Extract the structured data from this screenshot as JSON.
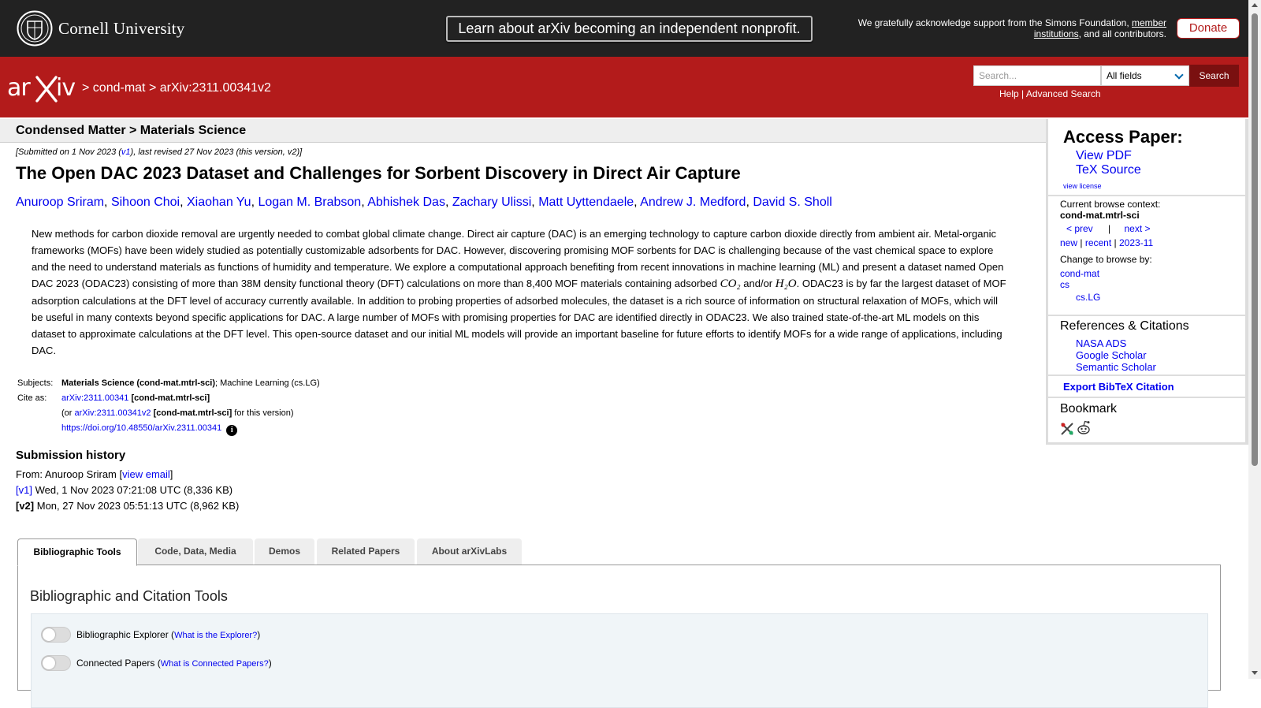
{
  "topbar": {
    "cornell_text": "Cornell University",
    "nonprofit_label": "Learn about arXiv becoming an independent nonprofit.",
    "ack_prefix": "We gratefully acknowledge support from the Simons Foundation, ",
    "ack_link": "member institutions",
    "ack_suffix": ", and all contributors.",
    "donate_label": "Donate"
  },
  "header": {
    "crumb_sep": ">",
    "crumb_1": "cond-mat",
    "crumb_2": "arXiv:2311.00341v2",
    "search_placeholder": "Search...",
    "field_selected": "All fields",
    "search_button": "Search",
    "help": "Help",
    "pipe": "|",
    "advanced": "Advanced Search"
  },
  "subheader": {
    "category": "Condensed Matter > Materials Science"
  },
  "paper": {
    "date_prefix": "[Submitted on 1 Nov 2023 (",
    "date_v1": "v1",
    "date_suffix": "), last revised 27 Nov 2023 (this version, v2)]",
    "title": "The Open DAC 2023 Dataset and Challenges for Sorbent Discovery in Direct Air Capture",
    "authors": [
      "Anuroop Sriram",
      "Sihoon Choi",
      "Xiaohan Yu",
      "Logan M. Brabson",
      "Abhishek Das",
      "Zachary Ulissi",
      "Matt Uyttendaele",
      "Andrew J. Medford",
      "David S. Sholl"
    ],
    "abstract_part1": "New methods for carbon dioxide removal are urgently needed to combat global climate change. Direct air capture (DAC) is an emerging technology to capture carbon dioxide directly from ambient air. Metal-organic frameworks (MOFs) have been widely studied as potentially customizable adsorbents for DAC. However, discovering promising MOF sorbents for DAC is challenging because of the vast chemical space to explore and the need to understand materials as functions of humidity and temperature. We explore a computational approach benefiting from recent innovations in machine learning (ML) and present a dataset named Open DAC 2023 (ODAC23) consisting of more than 38M density functional theory (DFT) calculations on more than 8,400 MOF materials containing adsorbed ",
    "abstract_co2": "CO₂",
    "abstract_and": " and/or ",
    "abstract_h2o": "H₂O",
    "abstract_part2": ". ODAC23 is by far the largest dataset of MOF adsorption calculations at the DFT level of accuracy currently available. In addition to probing properties of adsorbed molecules, the dataset is a rich source of information on structural relaxation of MOFs, which will be useful in many contexts beyond specific applications for DAC. A large number of MOFs with promising properties for DAC are identified directly in ODAC23. We also trained state-of-the-art ML models on this dataset to approximate calculations at the DFT level. This open-source dataset and our initial ML models will provide an important baseline for future efforts to identify MOFs for a wide range of applications, including DAC.",
    "subjects_label": "Subjects:",
    "subjects_primary": "Materials Science (cond-mat.mtrl-sci)",
    "subjects_rest": "; Machine Learning (cs.LG)",
    "cite_label": "Cite as:",
    "cite_id": "arXiv:2311.00341",
    "cite_cat": "[cond-mat.mtrl-sci]",
    "cite_or_prefix": "(or ",
    "cite_v2": "arXiv:2311.00341v2",
    "cite_or_suffix": " for this version)",
    "doi": "https://doi.org/10.48550/arXiv.2311.00341",
    "info_glyph": "i"
  },
  "history": {
    "title": "Submission history",
    "from_prefix": "From: Anuroop Sriram [",
    "view_email": "view email",
    "from_suffix": "]",
    "v1_label": "[v1]",
    "v1_text": " Wed, 1 Nov 2023 07:21:08 UTC (8,336 KB)",
    "v2_label": "[v2]",
    "v2_text": " Mon, 27 Nov 2023 05:51:13 UTC (8,962 KB)"
  },
  "tabs": [
    "Bibliographic Tools",
    "Code, Data, Media",
    "Demos",
    "Related Papers",
    "About arXivLabs"
  ],
  "panel": {
    "title": "Bibliographic and Citation Tools",
    "tool1_label": "Bibliographic Explorer (",
    "tool1_link": "What is the Explorer?",
    "tool2_label": "Connected Papers (",
    "tool2_link": "What is Connected Papers?",
    "close_paren": ")"
  },
  "sidebar": {
    "access_title": "Access Paper:",
    "view_pdf": "View PDF",
    "tex_source": "TeX Source",
    "view_license": "view license",
    "ctx_label": "Current browse context:",
    "ctx_value": "cond-mat.mtrl-sci",
    "prev": "< prev",
    "pipe": "|",
    "next": "next >",
    "new": "new",
    "recent": "recent",
    "month": "2023-11",
    "change_label": "Change to browse by:",
    "browse_1": "cond-mat",
    "browse_2": "cs",
    "browse_3": "cs.LG",
    "refs_title": "References & Citations",
    "nasa": "NASA ADS",
    "google": "Google Scholar",
    "semantic": "Semantic Scholar",
    "export": "Export BibTeX Citation",
    "bookmark": "Bookmark"
  },
  "colors": {
    "arxiv_red": "#b31b1b",
    "topbar": "#222222",
    "link": "#0000ee"
  },
  "icons": [
    "cornell-seal-icon",
    "arxiv-logo-icon",
    "chevron-down-icon",
    "info-icon",
    "bibsonomy-icon",
    "reddit-icon"
  ]
}
